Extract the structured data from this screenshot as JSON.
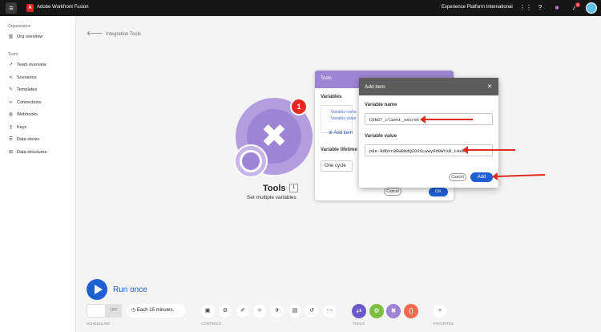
{
  "topbar": {
    "app_title": "Adobe Workfront Fusion",
    "org_name": "Experience Platform International",
    "notif_count": "6"
  },
  "sidebar": {
    "section_org": "Organization",
    "org_overview": "Org overview",
    "section_team": "Team",
    "items": [
      {
        "label": "Team overview"
      },
      {
        "label": "Scenarios"
      },
      {
        "label": "Templates"
      },
      {
        "label": "Connections"
      },
      {
        "label": "Webhooks"
      },
      {
        "label": "Keys"
      },
      {
        "label": "Data stores"
      },
      {
        "label": "Data structures"
      }
    ]
  },
  "breadcrumb": "Integration Tools",
  "module": {
    "title": "Tools",
    "number": "1",
    "subtitle": "Set multiple variables",
    "badge": "1"
  },
  "tools_panel": {
    "title": "Tools",
    "variables_label": "Variables",
    "var_name_label": "Variable name",
    "var_value_label": "Variable value",
    "add_item": "Add item",
    "lifetime_label": "Variable lifetime",
    "lifetime_value": "One cycle",
    "cancel": "Cancel",
    "ok": "OK"
  },
  "add_item_dialog": {
    "title": "Add item",
    "name_label": "Variable name",
    "name_value": "CONST_client_secret",
    "value_label": "Variable value",
    "value_value": "p8e-RdbVr8EW8NdQZD3SLwwyRd0WYxR_tAe8",
    "cancel": "Cancel",
    "add": "Add"
  },
  "footer": {
    "run_once": "Run once",
    "toggle_off": "OFF",
    "schedule": "Each 15 minutes.",
    "scheduling_label": "SCHEDULING",
    "controls_label": "CONTROLS",
    "tools_label": "TOOLS",
    "favorites_label": "FAVORITES"
  },
  "colors": {
    "accent": "#1e5fd3",
    "module_purple": "#9e84d4",
    "badge_red": "#e02b20"
  }
}
